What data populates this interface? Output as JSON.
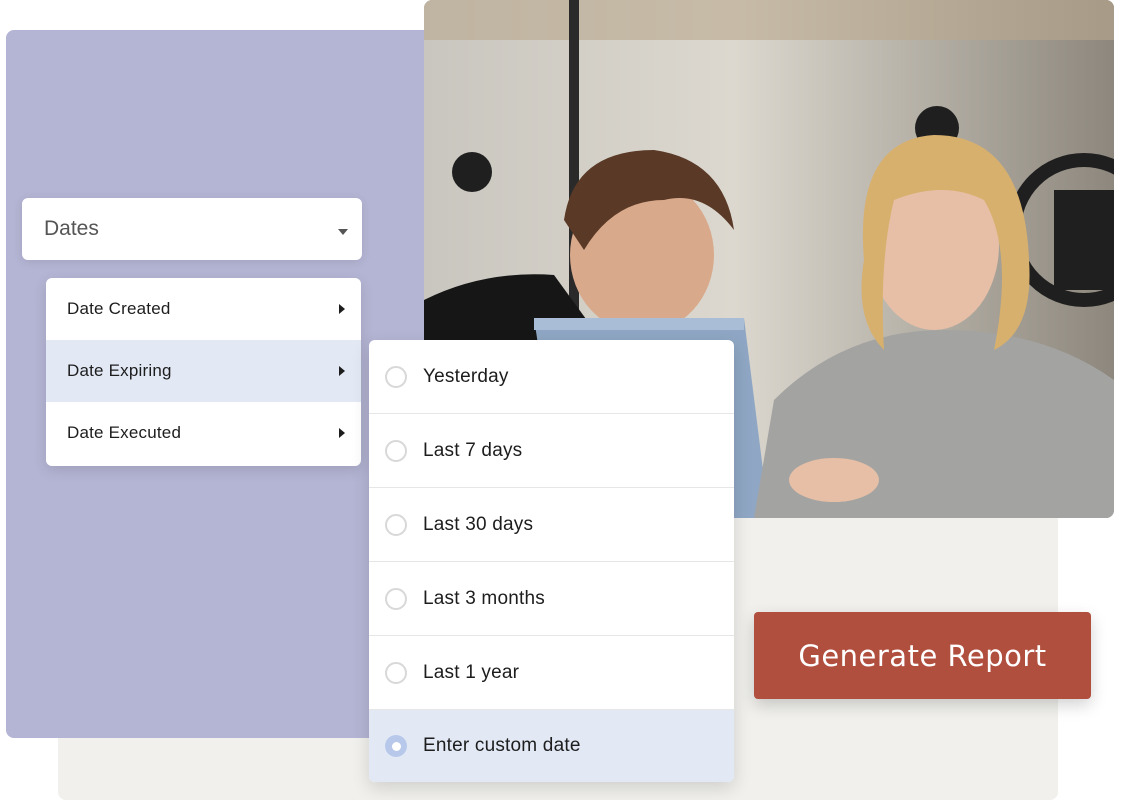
{
  "dates_select": {
    "label": "Dates",
    "icon": "caret-down-icon"
  },
  "date_fields": [
    {
      "label": "Date Created",
      "active": false
    },
    {
      "label": "Date Expiring",
      "active": true
    },
    {
      "label": "Date Executed",
      "active": false
    }
  ],
  "range_options": [
    {
      "label": "Yesterday",
      "selected": false
    },
    {
      "label": "Last 7 days",
      "selected": false
    },
    {
      "label": "Last 30 days",
      "selected": false
    },
    {
      "label": "Last 3 months",
      "selected": false
    },
    {
      "label": "Last 1 year",
      "selected": false
    },
    {
      "label": "Enter custom date",
      "selected": true
    }
  ],
  "generate_button": {
    "label": "Generate Report"
  },
  "colors": {
    "panel_purple": "#b4b5d4",
    "panel_gray": "#f1f0ec",
    "highlight_blue": "#e2e9f5",
    "radio_selected": "#b7c8ea",
    "button_brand": "#b14f3f"
  }
}
